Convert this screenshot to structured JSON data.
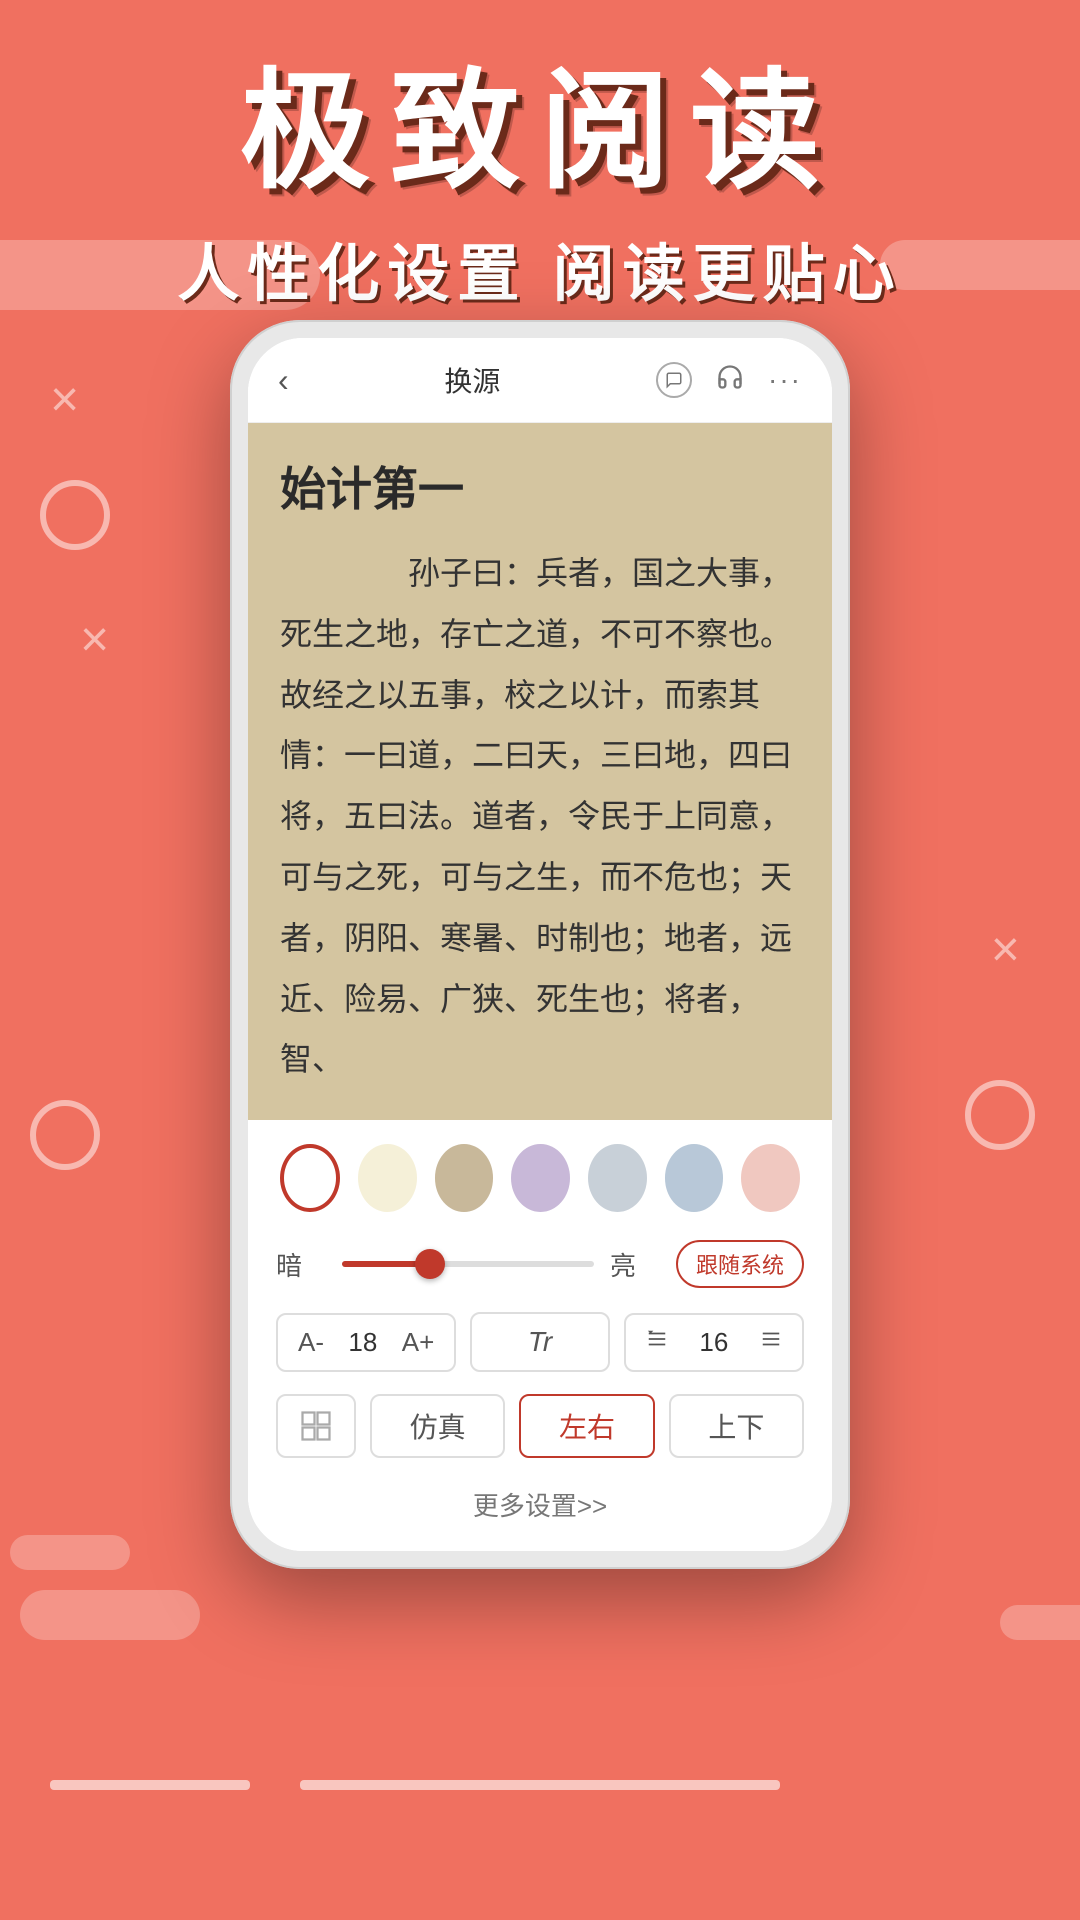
{
  "header": {
    "title_main": "极致阅读",
    "title_sub": "人性化设置  阅读更贴心"
  },
  "topbar": {
    "back": "‹",
    "title": "换源",
    "speech_icon": "💬",
    "headphone_icon": "🎧",
    "more_icon": "···"
  },
  "reading": {
    "chapter_title": "始计第一",
    "chapter_text": "　　孙子曰：兵者，国之大事，死生之地，存亡之道，不可不察也。故经之以五事，校之以计，而索其情：一曰道，二曰天，三曰地，四曰将，五曰法。道者，令民于上同意，可与之死，可与之生，而不危也；天者，阴阳、寒暑、时制也；地者，远近、险易、广狭、死生也；将者，智、"
  },
  "settings": {
    "colors": [
      {
        "color": "#FFFFFF",
        "active": true
      },
      {
        "color": "#F5F0D8",
        "active": false
      },
      {
        "color": "#C8B89A",
        "active": false
      },
      {
        "color": "#C8B8D8",
        "active": false
      },
      {
        "color": "#C8D0D8",
        "active": false
      },
      {
        "color": "#B8C8D8",
        "active": false
      },
      {
        "color": "#F0C8C0",
        "active": false
      }
    ],
    "brightness": {
      "dark_label": "暗",
      "light_label": "亮",
      "follow_system": "跟随系统",
      "fill_percent": 35
    },
    "font_size": {
      "decrease": "A-",
      "value": "18",
      "increase": "A+"
    },
    "font_type": {
      "label": "Tr"
    },
    "line_spacing": {
      "icon_up": "÷",
      "value": "16",
      "icon_down": "≑"
    },
    "layout": {
      "grid_icon": "▦",
      "fanzhen": "仿真",
      "zuoyou": "左右",
      "shangxia": "上下",
      "active": "左右"
    },
    "more": "更多设置>>"
  }
}
